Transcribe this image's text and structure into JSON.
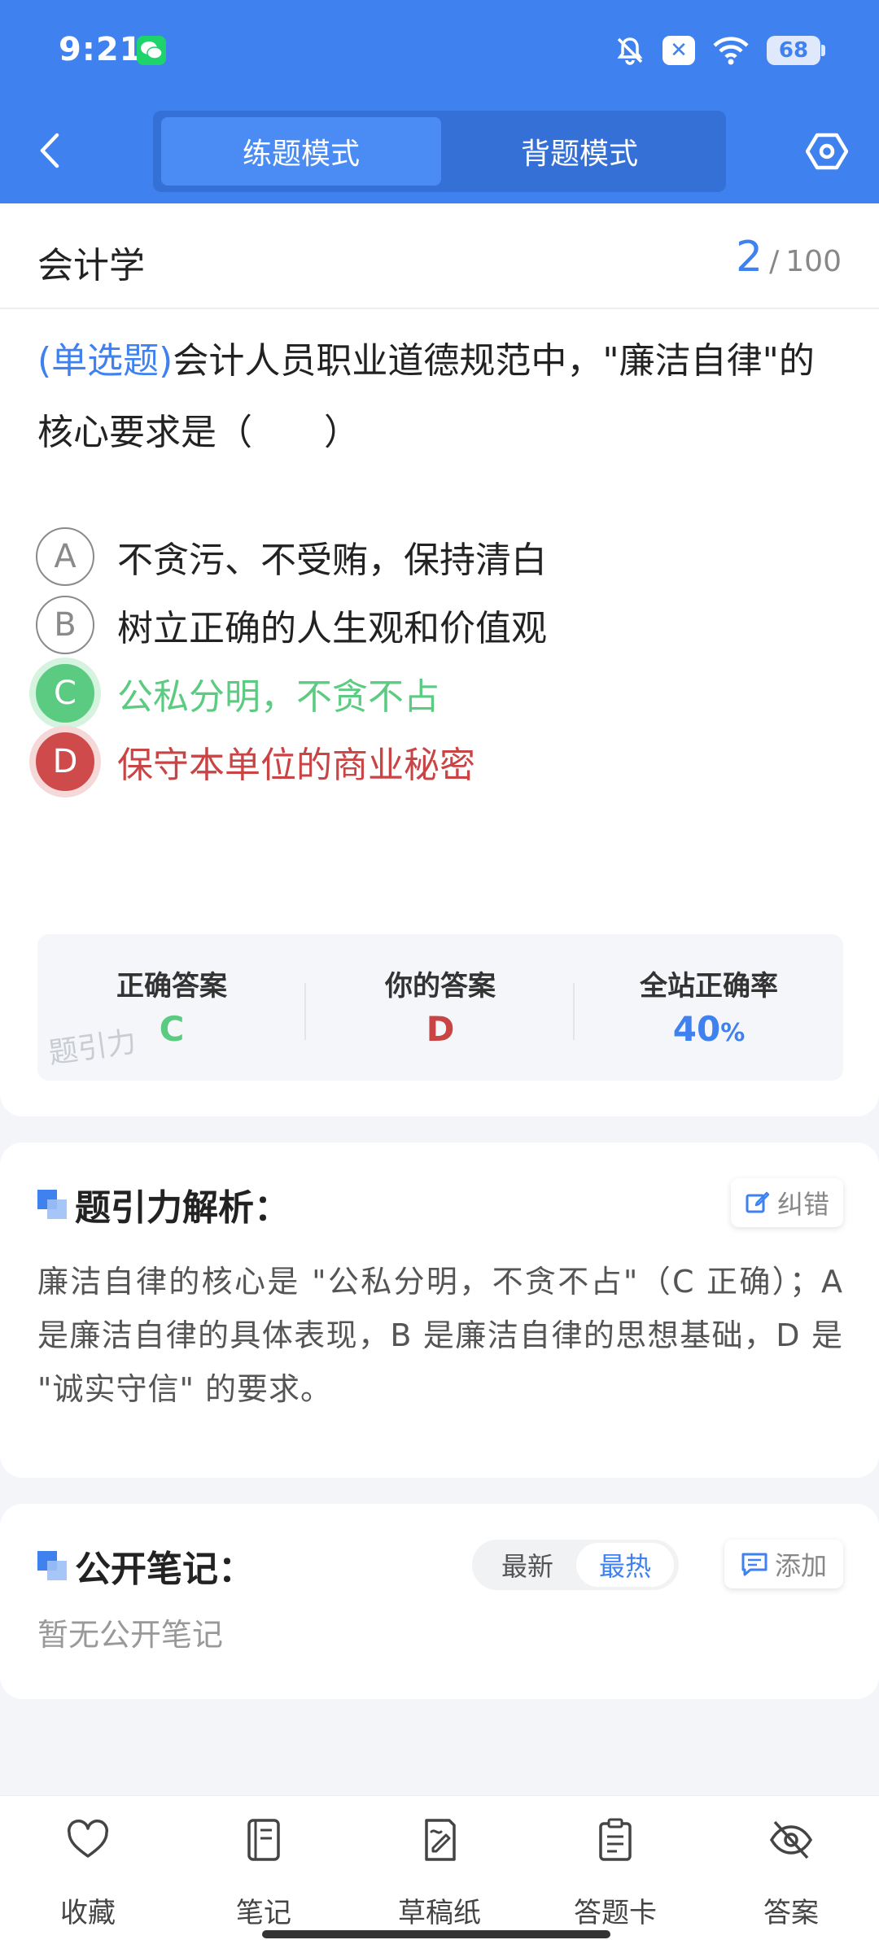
{
  "status_bar": {
    "time": "9:21",
    "battery": "68"
  },
  "nav": {
    "mode_practice": "练题模式",
    "mode_memorize": "背题模式"
  },
  "subject": {
    "name": "会计学",
    "current": "2",
    "separator": "/",
    "total": "100"
  },
  "question": {
    "type_label": "(单选题)",
    "text": "会计人员职业道德规范中，\"廉洁自律\"的核心要求是（　　）",
    "options": [
      {
        "letter": "A",
        "text": "不贪污、不受贿，保持清白",
        "state": "normal"
      },
      {
        "letter": "B",
        "text": "树立正确的人生观和价值观",
        "state": "normal"
      },
      {
        "letter": "C",
        "text": "公私分明，不贪不占",
        "state": "correct"
      },
      {
        "letter": "D",
        "text": "保守本单位的商业秘密",
        "state": "wrong"
      }
    ]
  },
  "answer_summary": {
    "correct_label": "正确答案",
    "correct_value": "C",
    "yours_label": "你的答案",
    "yours_value": "D",
    "rate_label": "全站正确率",
    "rate_value": "40",
    "rate_unit": "%",
    "watermark": "题引力"
  },
  "analysis": {
    "title": "题引力解析：",
    "report_button": "纠错",
    "text": "廉洁自律的核心是 \"公私分明，不贪不占\"（C 正确）；A 是廉洁自律的具体表现，B 是廉洁自律的思想基础，D 是 \"诚实守信\" 的要求。"
  },
  "notes": {
    "title": "公开笔记：",
    "sort_latest": "最新",
    "sort_hot": "最热",
    "add_button": "添加",
    "empty_text": "暂无公开笔记"
  },
  "bottom_bar": [
    {
      "label": "收藏",
      "icon": "heart-icon"
    },
    {
      "label": "笔记",
      "icon": "notebook-icon"
    },
    {
      "label": "草稿纸",
      "icon": "draft-paper-icon"
    },
    {
      "label": "答题卡",
      "icon": "answer-sheet-icon"
    },
    {
      "label": "答案",
      "icon": "eye-off-icon"
    }
  ],
  "colors": {
    "primary": "#3f81ee",
    "correct": "#5ccb82",
    "wrong": "#c94444"
  }
}
